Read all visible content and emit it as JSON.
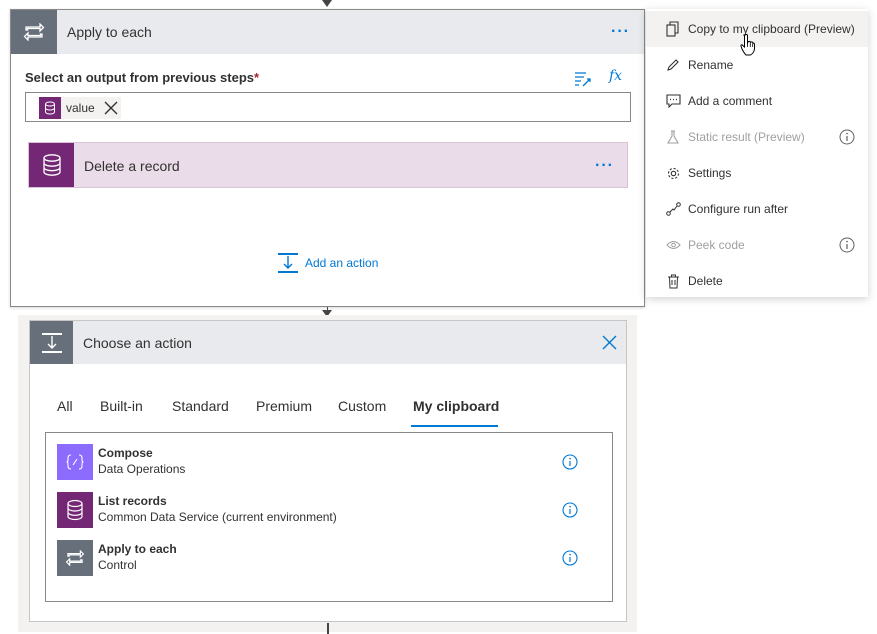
{
  "apply_each": {
    "title": "Apply to each",
    "select_label": "Select an output from previous steps",
    "required_mark": "*",
    "fx_label": "fx",
    "token_value": "value",
    "inner_action": {
      "title": "Delete a record"
    },
    "add_action_label": "Add an action"
  },
  "context_menu": {
    "items": [
      {
        "label": "Copy to my clipboard (Preview)",
        "icon": "copy-icon",
        "enabled": true,
        "hovered": true
      },
      {
        "label": "Rename",
        "icon": "pencil-icon",
        "enabled": true
      },
      {
        "label": "Add a comment",
        "icon": "comment-icon",
        "enabled": true
      },
      {
        "label": "Static result (Preview)",
        "icon": "flask-icon",
        "enabled": false,
        "info": true
      },
      {
        "label": "Settings",
        "icon": "gear-icon",
        "enabled": true
      },
      {
        "label": "Configure run after",
        "icon": "run-after-icon",
        "enabled": true
      },
      {
        "label": "Peek code",
        "icon": "eye-icon",
        "enabled": false,
        "info": true
      },
      {
        "label": "Delete",
        "icon": "trash-icon",
        "enabled": true
      }
    ]
  },
  "choose_action": {
    "title": "Choose an action",
    "tabs": [
      {
        "label": "All",
        "active": false
      },
      {
        "label": "Built-in",
        "active": false
      },
      {
        "label": "Standard",
        "active": false
      },
      {
        "label": "Premium",
        "active": false
      },
      {
        "label": "Custom",
        "active": false
      },
      {
        "label": "My clipboard",
        "active": true
      }
    ],
    "results": [
      {
        "title": "Compose",
        "subtitle": "Data Operations",
        "icon": "compose-icon",
        "color": "#8c6cff"
      },
      {
        "title": "List records",
        "subtitle": "Common Data Service (current environment)",
        "icon": "database-icon",
        "color": "#742774"
      },
      {
        "title": "Apply to each",
        "subtitle": "Control",
        "icon": "loop-icon",
        "color": "#666f7a"
      }
    ]
  },
  "colors": {
    "accent": "#0078d4",
    "cds_purple": "#742774",
    "control_gray": "#666f7a",
    "compose_purple": "#8c6cff"
  }
}
